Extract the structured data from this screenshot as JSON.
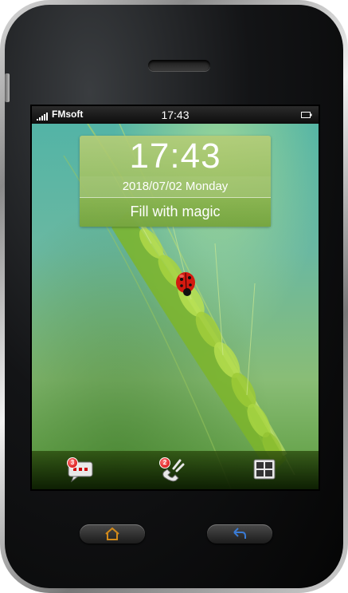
{
  "status_bar": {
    "carrier": "FMsoft",
    "time": "17:43"
  },
  "lock_clock": {
    "time": "17:43",
    "date": "2018/07/02 Monday",
    "slogan": "Fill with magic"
  },
  "dock": {
    "items": [
      {
        "icon": "message-icon",
        "badge": "3"
      },
      {
        "icon": "phone-icon",
        "badge": "2"
      },
      {
        "icon": "grid-icon"
      }
    ]
  },
  "hardware": {
    "home_icon": "home-icon",
    "back_icon": "back-icon",
    "home_color": "#d28a1a",
    "back_color": "#3a7bd5"
  }
}
